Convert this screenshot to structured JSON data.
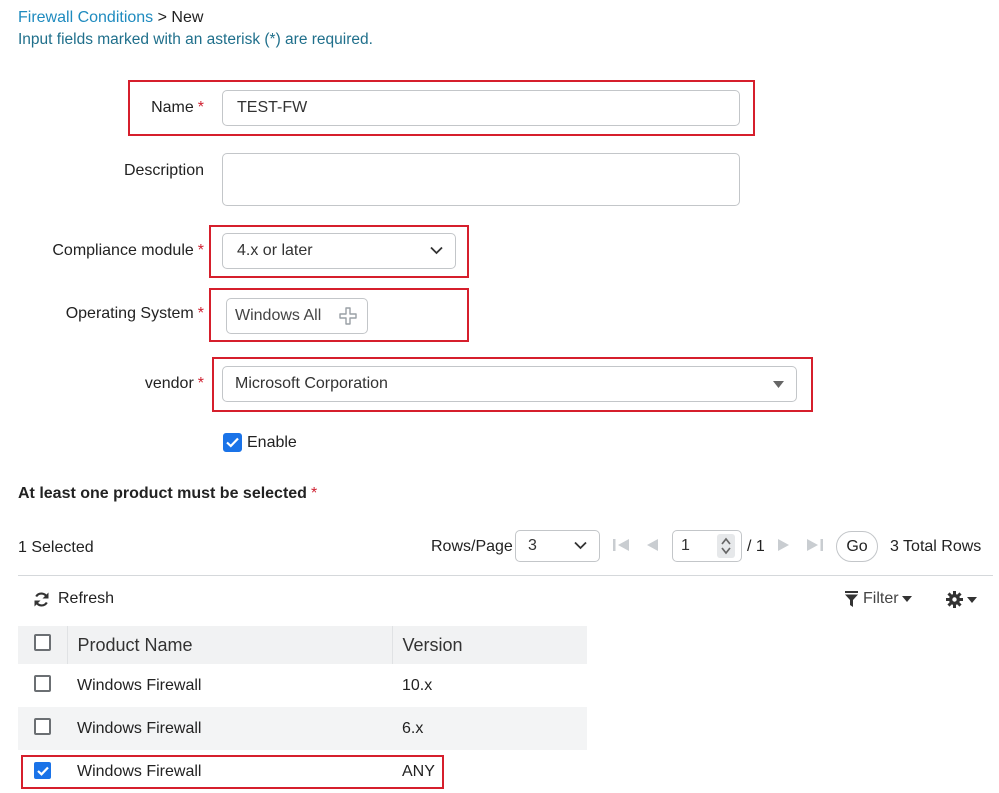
{
  "breadcrumb": {
    "link": "Firewall Conditions",
    "separator": " > ",
    "current": "New"
  },
  "required_note": "Input fields marked with an asterisk (*) are required.",
  "form": {
    "name": {
      "label": "Name",
      "value": "TEST-FW"
    },
    "description": {
      "label": "Description",
      "value": ""
    },
    "compliance_module": {
      "label": "Compliance module",
      "value": "4.x or later"
    },
    "operating_system": {
      "label": "Operating System",
      "value": "Windows All"
    },
    "vendor": {
      "label": "vendor",
      "value": "Microsoft Corporation"
    },
    "enable": {
      "label": "Enable",
      "checked": true
    },
    "asterisk": "*"
  },
  "products_heading": "At least one product must be selected",
  "pager": {
    "selected_text": "1 Selected",
    "rows_per_page_label": "Rows/Page",
    "rows_per_page": "3",
    "page": "1",
    "total_pages": "/ 1",
    "go_label": "Go",
    "total_rows": "3 Total Rows"
  },
  "toolbar": {
    "refresh_label": "Refresh",
    "filter_label": "Filter"
  },
  "table": {
    "columns": [
      "Product Name",
      "Version"
    ],
    "rows": [
      {
        "name": "Windows Firewall",
        "version": "10.x",
        "checked": false
      },
      {
        "name": "Windows Firewall",
        "version": "6.x",
        "checked": false
      },
      {
        "name": "Windows Firewall",
        "version": "ANY",
        "checked": true
      }
    ]
  },
  "colors": {
    "accent": "#1a73e8",
    "highlight": "#d61f2c",
    "link": "#1f8bbf",
    "required": "#cf2030"
  },
  "icons": [
    "chevron-down-icon",
    "caret-down-icon",
    "plus-icon",
    "refresh-icon",
    "filter-icon",
    "gear-icon",
    "first-page-icon",
    "prev-page-icon",
    "next-page-icon",
    "last-page-icon",
    "spinner-icon",
    "checkmark-icon"
  ]
}
